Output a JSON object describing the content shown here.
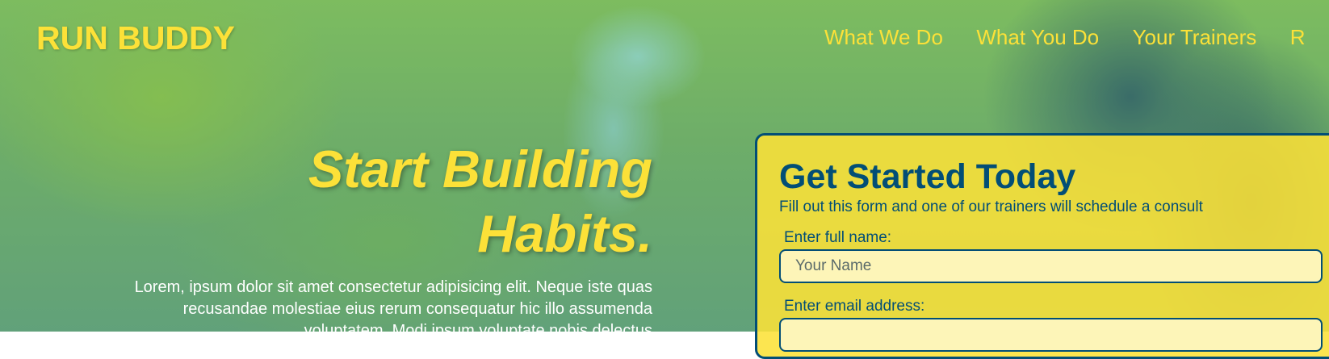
{
  "header": {
    "brand": "RUN BUDDY",
    "nav": [
      "What We Do",
      "What You Do",
      "Your Trainers",
      "R"
    ]
  },
  "hero": {
    "title_line1": "Start Building",
    "title_line2": "Habits.",
    "body": "Lorem, ipsum dolor sit amet consectetur adipisicing elit. Neque iste quas recusandae molestiae eius rerum consequatur hic illo assumenda voluptatem. Modi ipsum voluptate nobis delectus"
  },
  "form": {
    "title": "Get Started Today",
    "subtitle": "Fill out this form and one of our trainers will schedule a consult",
    "name_label": "Enter full name:",
    "name_placeholder": "Your Name",
    "email_label": "Enter email address:",
    "email_placeholder": ""
  },
  "colors": {
    "accent_yellow": "#fce138",
    "primary_blue": "#024e76",
    "input_bg": "#fdf5b8"
  }
}
